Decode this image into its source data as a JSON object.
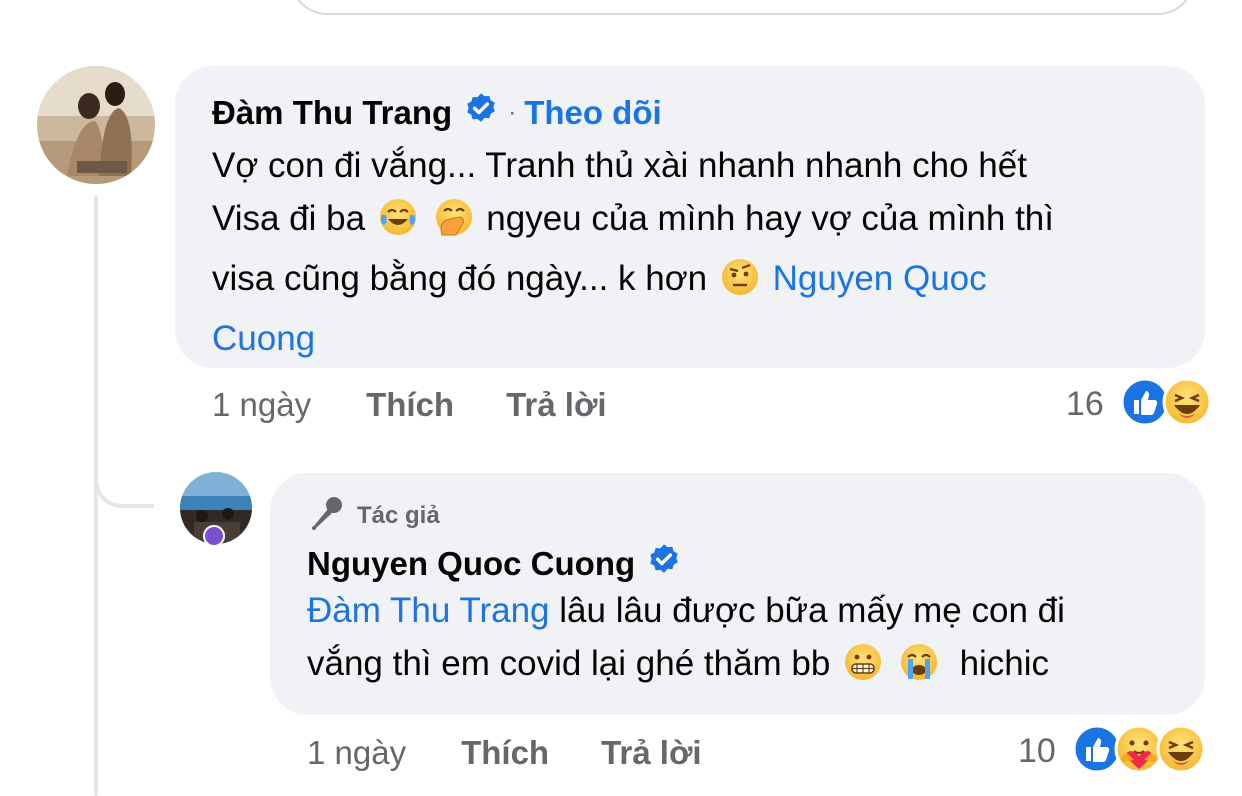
{
  "comment": {
    "author": "Đàm Thu Trang",
    "follow_label": "Theo dõi",
    "separator": "·",
    "line1": "Vợ con đi vắng... Tranh thủ xài nhanh nhanh cho hết",
    "line2a": "Visa đi ba",
    "line2b": "ngyeu của mình hay vợ của mình thì",
    "line3a": "visa cũng bằng đó ngày... k hơn",
    "mention_a": "Nguyen Quoc",
    "mention_b": "Cuong",
    "time": "1 ngày",
    "like_label": "Thích",
    "reply_label": "Trả lời",
    "reaction_count": "16",
    "emojis": [
      "tears-of-joy-emoji",
      "hand-over-mouth-emoji",
      "raised-eyebrow-emoji"
    ],
    "reactions": [
      "like-reaction-icon",
      "haha-reaction-icon"
    ]
  },
  "reply": {
    "badge": "Tác giả",
    "author": "Nguyen Quoc Cuong",
    "mention": "Đàm Thu Trang",
    "line1": "lâu lâu được bữa mấy mẹ con đi",
    "line2a": "vắng thì em covid lại ghé thăm bb",
    "line2b": "hichic",
    "time": "1 ngày",
    "like_label": "Thích",
    "reply_label": "Trả lời",
    "reaction_count": "10",
    "emojis": [
      "grimacing-emoji",
      "loudly-crying-emoji"
    ],
    "reactions": [
      "like-reaction-icon",
      "care-reaction-icon",
      "haha-reaction-icon"
    ]
  },
  "colors": {
    "link": "#1b74e4",
    "bubble": "#f0f2f5",
    "meta": "#65676b",
    "thread": "#e4e6eb"
  }
}
